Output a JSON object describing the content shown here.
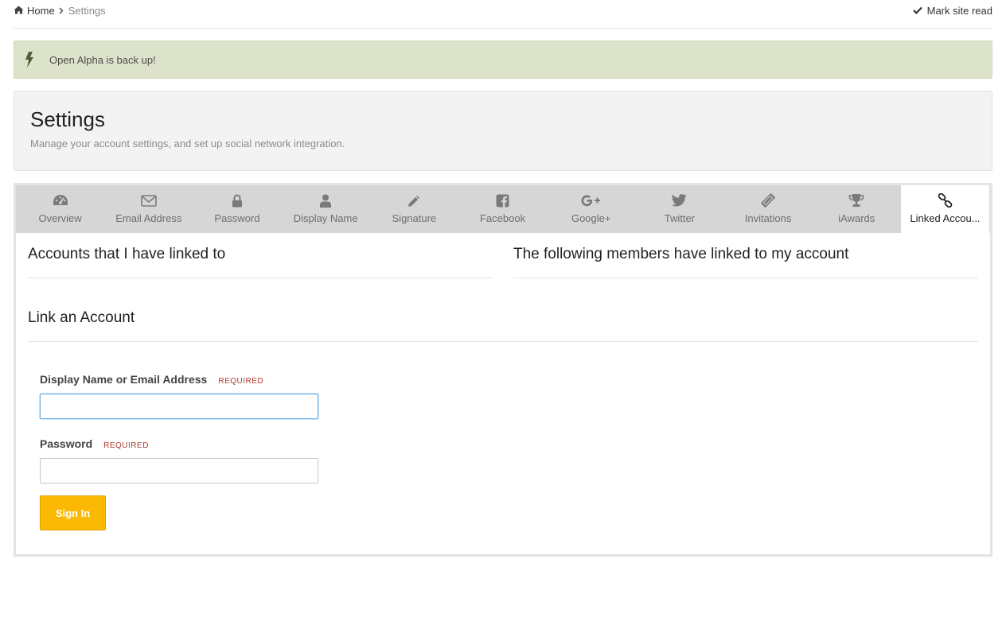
{
  "breadcrumb": {
    "home": "Home",
    "current": "Settings"
  },
  "mark_read": "Mark site read",
  "notice": {
    "message": "Open Alpha is back up!"
  },
  "header": {
    "title": "Settings",
    "description": "Manage your account settings, and set up social network integration."
  },
  "tabs": [
    {
      "label": "Overview",
      "icon": "dashboard-icon"
    },
    {
      "label": "Email Address",
      "icon": "envelope-icon"
    },
    {
      "label": "Password",
      "icon": "lock-icon"
    },
    {
      "label": "Display Name",
      "icon": "user-icon"
    },
    {
      "label": "Signature",
      "icon": "pencil-icon"
    },
    {
      "label": "Facebook",
      "icon": "facebook-icon"
    },
    {
      "label": "Google+",
      "icon": "google-plus-icon"
    },
    {
      "label": "Twitter",
      "icon": "twitter-icon"
    },
    {
      "label": "Invitations",
      "icon": "ticket-icon"
    },
    {
      "label": "iAwards",
      "icon": "trophy-icon"
    },
    {
      "label": "Linked Accou...",
      "icon": "link-icon"
    }
  ],
  "active_tab": "Linked Accou...",
  "sections": {
    "linked_by_me": "Accounts that I have linked to",
    "linked_to_me": "The following members have linked to my account",
    "link_account": "Link an Account"
  },
  "form": {
    "identity_label": "Display Name or Email Address",
    "identity_value": "",
    "password_label": "Password",
    "password_value": "",
    "required_tag": "REQUIRED",
    "submit_label": "Sign In"
  },
  "colors": {
    "notice_bg": "#dde3cb",
    "tab_bar": "#d6d6d6",
    "signin_button": "#fbb903",
    "required": "#b03a2e"
  }
}
